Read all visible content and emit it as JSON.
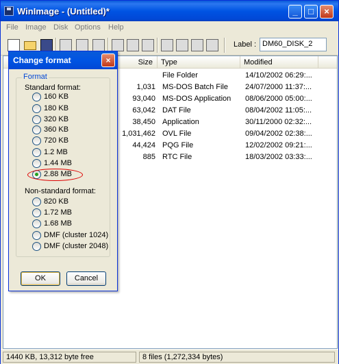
{
  "window": {
    "title": "WinImage - (Untitled)*"
  },
  "menu": [
    "File",
    "Image",
    "Disk",
    "Options",
    "Help"
  ],
  "toolbar": {
    "label_text": "Label :",
    "label_value": "DM60_DISK_2"
  },
  "columns": [
    "Size",
    "Type",
    "Modified"
  ],
  "files": [
    {
      "size": "",
      "type": "File Folder",
      "modified": "14/10/2002 06:29:..."
    },
    {
      "size": "1,031",
      "type": "MS-DOS Batch File",
      "modified": "24/07/2000 11:37:..."
    },
    {
      "size": "93,040",
      "type": "MS-DOS Application",
      "modified": "08/06/2000 05:00:..."
    },
    {
      "size": "63,042",
      "type": "DAT File",
      "modified": "08/04/2002 11:05:..."
    },
    {
      "size": "38,450",
      "type": "Application",
      "modified": "30/11/2000 02:32:..."
    },
    {
      "size": "1,031,462",
      "type": "OVL File",
      "modified": "09/04/2002 02:38:..."
    },
    {
      "size": "44,424",
      "type": "PQG File",
      "modified": "12/02/2002 09:21:..."
    },
    {
      "size": "885",
      "type": "RTC File",
      "modified": "18/03/2002 03:33:..."
    }
  ],
  "status": {
    "left": "1440 KB, 13,312 byte free",
    "right": "8 files (1,272,334 bytes)"
  },
  "dialog": {
    "title": "Change format",
    "group_label": "Format",
    "standard_label": "Standard format:",
    "standard": [
      {
        "label": "160 KB",
        "selected": false
      },
      {
        "label": "180 KB",
        "selected": false
      },
      {
        "label": "320 KB",
        "selected": false
      },
      {
        "label": "360 KB",
        "selected": false
      },
      {
        "label": "720 KB",
        "selected": false
      },
      {
        "label": "1.2 MB",
        "selected": false
      },
      {
        "label": "1.44 MB",
        "selected": false
      },
      {
        "label": "2.88 MB",
        "selected": true
      }
    ],
    "nonstandard_label": "Non-standard format:",
    "nonstandard": [
      {
        "label": "820 KB",
        "selected": false
      },
      {
        "label": "1.72 MB",
        "selected": false
      },
      {
        "label": "1.68 MB",
        "selected": false
      },
      {
        "label": "DMF (cluster 1024)",
        "selected": false
      },
      {
        "label": "DMF (cluster 2048)",
        "selected": false
      }
    ],
    "ok": "OK",
    "cancel": "Cancel"
  }
}
